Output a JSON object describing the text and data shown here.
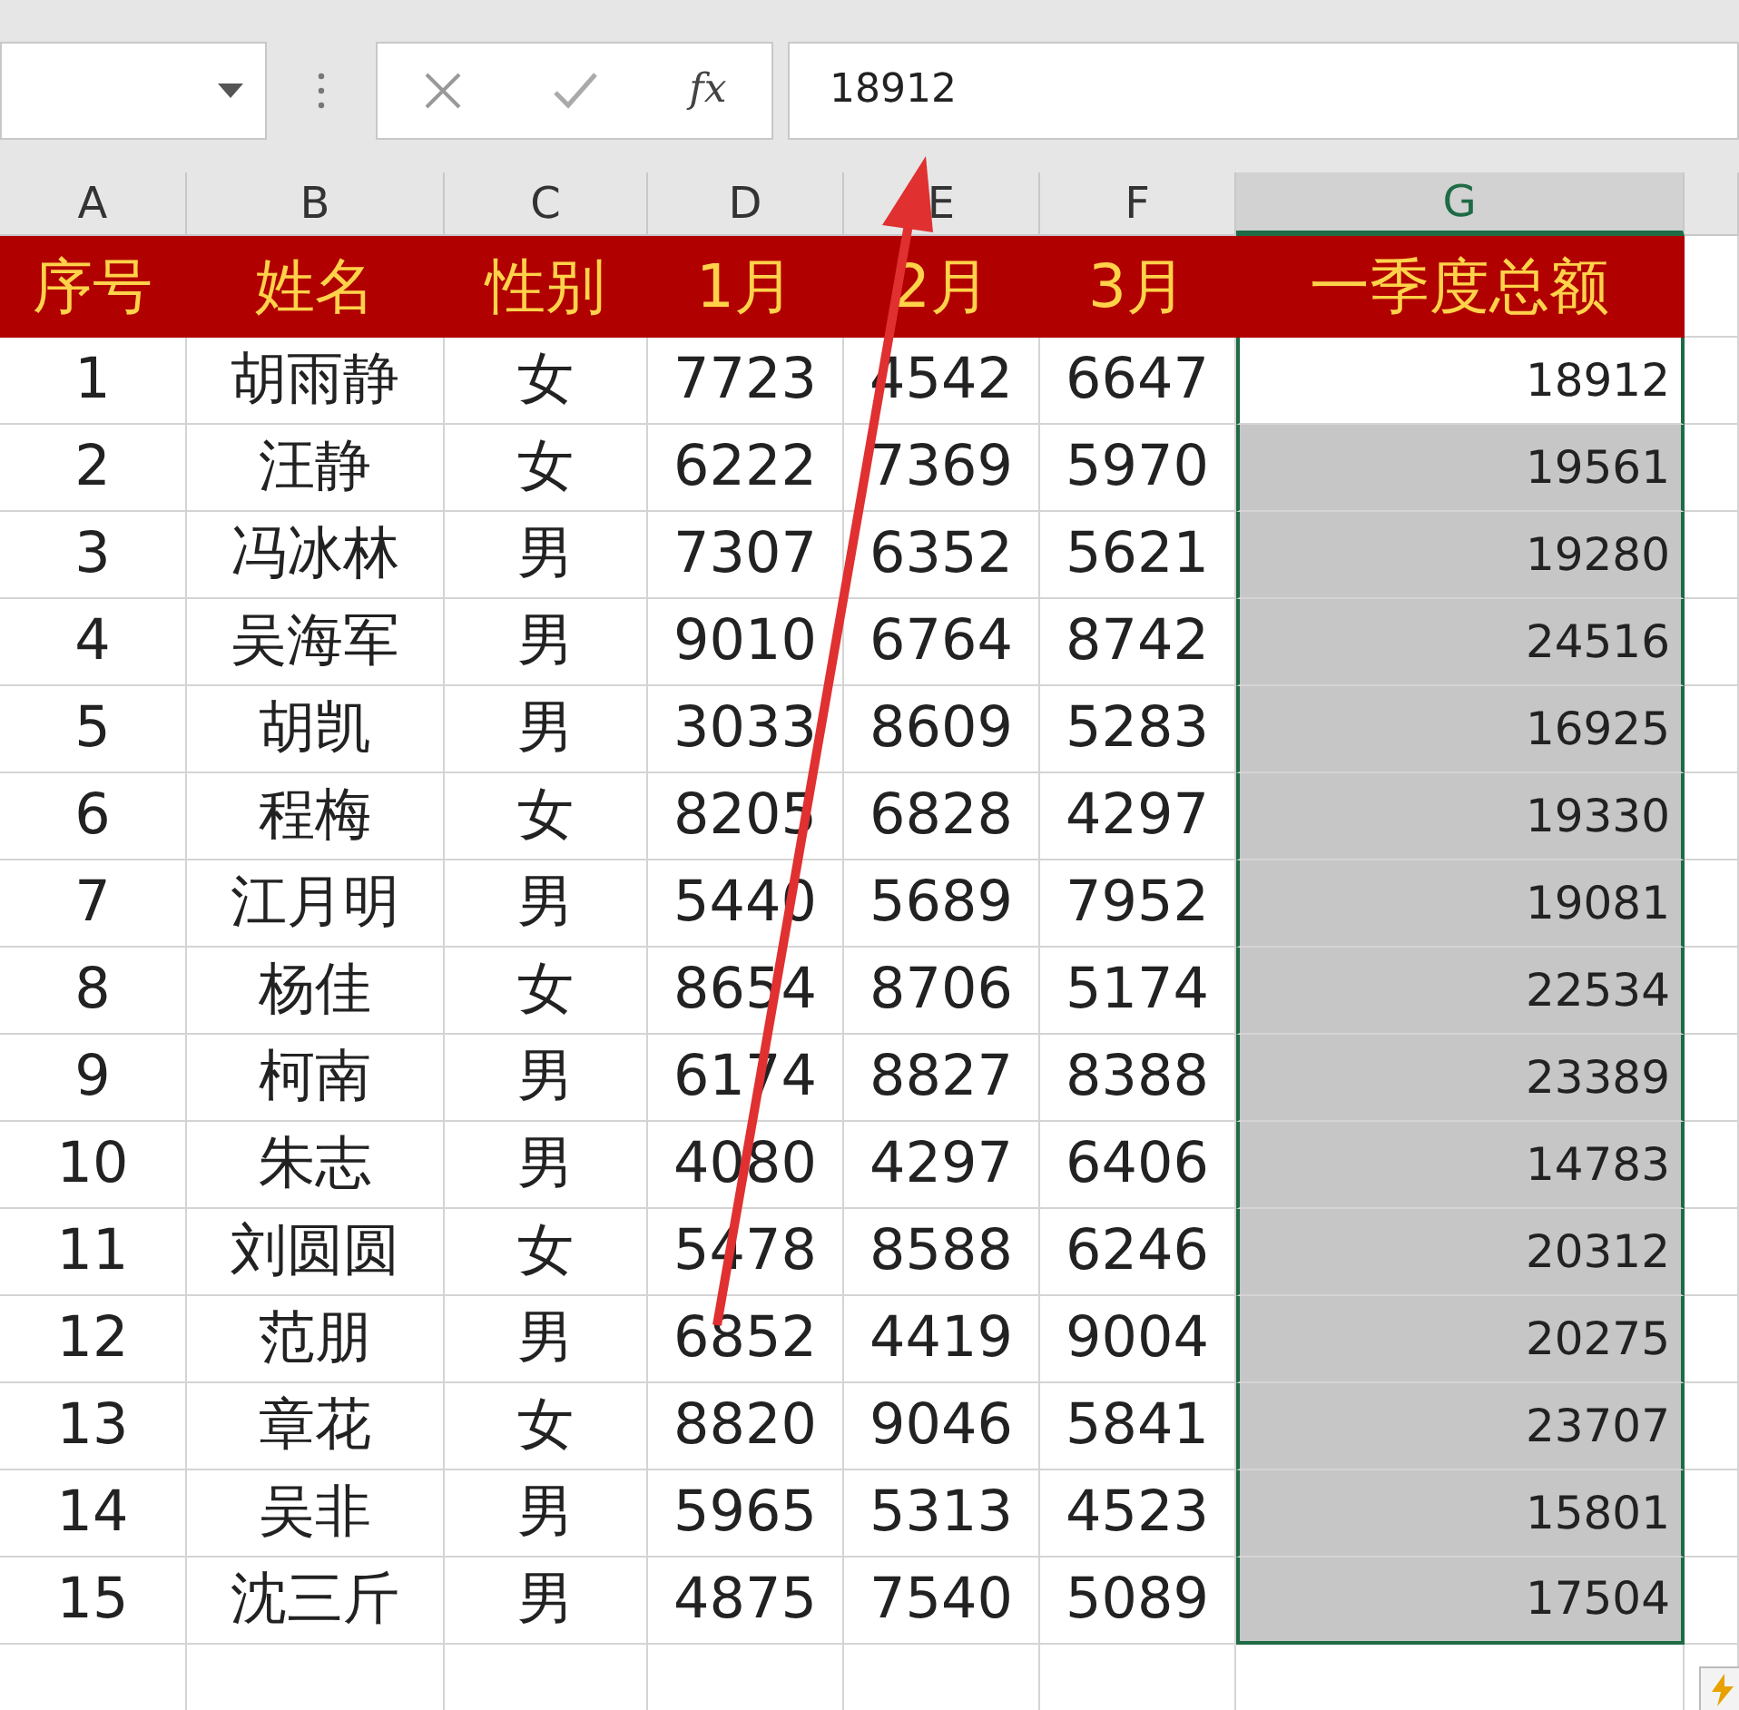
{
  "formula_bar": {
    "function_label": "fx",
    "value": "18912"
  },
  "sheet": {
    "columns": [
      {
        "label": "A",
        "selected": false
      },
      {
        "label": "B",
        "selected": false
      },
      {
        "label": "C",
        "selected": false
      },
      {
        "label": "D",
        "selected": false
      },
      {
        "label": "E",
        "selected": false
      },
      {
        "label": "F",
        "selected": false
      },
      {
        "label": "G",
        "selected": true
      }
    ],
    "header": [
      "序号",
      "姓名",
      "性别",
      "1月",
      "2月",
      "3月",
      "一季度总额"
    ],
    "rows": [
      {
        "cells": [
          "1",
          "胡雨静",
          "女",
          "7723",
          "4542",
          "6647",
          "18912"
        ],
        "active": true
      },
      {
        "cells": [
          "2",
          "汪静",
          "女",
          "6222",
          "7369",
          "5970",
          "19561"
        ],
        "active": false
      },
      {
        "cells": [
          "3",
          "冯冰林",
          "男",
          "7307",
          "6352",
          "5621",
          "19280"
        ],
        "active": false
      },
      {
        "cells": [
          "4",
          "吴海军",
          "男",
          "9010",
          "6764",
          "8742",
          "24516"
        ],
        "active": false
      },
      {
        "cells": [
          "5",
          "胡凯",
          "男",
          "3033",
          "8609",
          "5283",
          "16925"
        ],
        "active": false
      },
      {
        "cells": [
          "6",
          "程梅",
          "女",
          "8205",
          "6828",
          "4297",
          "19330"
        ],
        "active": false
      },
      {
        "cells": [
          "7",
          "江月明",
          "男",
          "5440",
          "5689",
          "7952",
          "19081"
        ],
        "active": false
      },
      {
        "cells": [
          "8",
          "杨佳",
          "女",
          "8654",
          "8706",
          "5174",
          "22534"
        ],
        "active": false
      },
      {
        "cells": [
          "9",
          "柯南",
          "男",
          "6174",
          "8827",
          "8388",
          "23389"
        ],
        "active": false
      },
      {
        "cells": [
          "10",
          "朱志",
          "男",
          "4080",
          "4297",
          "6406",
          "14783"
        ],
        "active": false
      },
      {
        "cells": [
          "11",
          "刘圆圆",
          "女",
          "5478",
          "8588",
          "6246",
          "20312"
        ],
        "active": false
      },
      {
        "cells": [
          "12",
          "范朋",
          "男",
          "6852",
          "4419",
          "9004",
          "20275"
        ],
        "active": false
      },
      {
        "cells": [
          "13",
          "章花",
          "女",
          "8820",
          "9046",
          "5841",
          "23707"
        ],
        "active": false
      },
      {
        "cells": [
          "14",
          "吴非",
          "男",
          "5965",
          "5313",
          "4523",
          "15801"
        ],
        "active": false
      },
      {
        "cells": [
          "15",
          "沈三斤",
          "男",
          "4875",
          "7540",
          "5089",
          "17504"
        ],
        "active": false
      }
    ]
  }
}
